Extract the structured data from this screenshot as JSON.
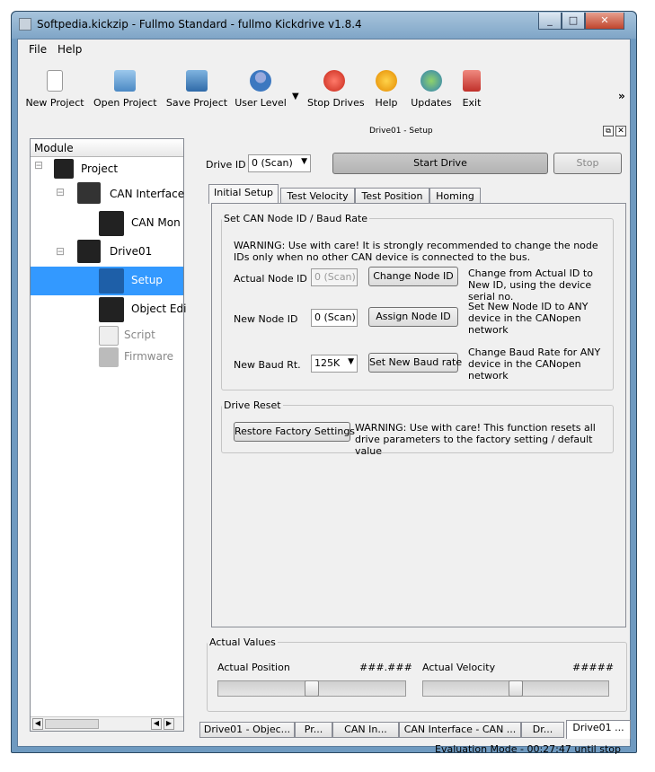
{
  "window": {
    "title": "Softpedia.kickzip - Fullmo Standard - fullmo Kickdrive v1.8.4",
    "min_icon": "minimize-icon",
    "max_icon": "maximize-icon",
    "close_icon": "close-icon"
  },
  "menu": {
    "file": "File",
    "help": "Help"
  },
  "toolbar": {
    "new_project": "New Project",
    "open_project": "Open Project",
    "save_project": "Save Project",
    "user_level": "User Level",
    "stop_drives": "Stop Drives",
    "help": "Help",
    "updates": "Updates",
    "exit": "Exit",
    "overflow": "»"
  },
  "module_panel": {
    "header": "Module",
    "items": [
      {
        "label": "Project",
        "icon": "home-icon"
      },
      {
        "label": "CAN Interface",
        "icon": "can-interface-icon"
      },
      {
        "label": "CAN Mon",
        "icon": "stethoscope-icon"
      },
      {
        "label": "Drive01",
        "icon": "drive-icon"
      },
      {
        "label": "Setup",
        "icon": "wrench-icon"
      },
      {
        "label": "Object Edi",
        "icon": "list-icon"
      },
      {
        "label": "Script",
        "icon": "script-icon"
      },
      {
        "label": "Firmware",
        "icon": "download-icon"
      }
    ]
  },
  "panel": {
    "title": "Drive01 - Setup"
  },
  "drive": {
    "label": "Drive ID",
    "value": "0 (Scan)",
    "start": "Start Drive",
    "stop": "Stop"
  },
  "tabs": [
    "Initial Setup",
    "Test Velocity",
    "Test Position",
    "Homing"
  ],
  "node_group": {
    "legend": "Set CAN Node ID / Baud Rate",
    "warning": "WARNING: Use with care! It is strongly recommended to change the node IDs only when no other CAN device is connected to the bus.",
    "actual_label": "Actual Node ID",
    "actual_value": "0 (Scan)",
    "change_button": "Change Node ID",
    "change_note": "Change from Actual ID to New ID, using the device serial no.",
    "new_label": "New Node ID",
    "new_value": "0 (Scan)",
    "assign_button": "Assign Node ID",
    "assign_note": "Set New Node ID to ANY device in the CANopen network",
    "baud_label": "New Baud Rt.",
    "baud_value": "125K",
    "baud_button": "Set New Baud rate",
    "baud_note": "Change Baud Rate for ANY device in the CANopen network"
  },
  "reset_group": {
    "legend": "Drive Reset",
    "button": "Restore Factory Settings",
    "warning": "WARNING: Use with care! This function resets all drive parameters to the factory setting / default value"
  },
  "actual_values": {
    "legend": "Actual Values",
    "position_label": "Actual Position",
    "position_value": "###.###",
    "velocity_label": "Actual Velocity",
    "velocity_value": "#####",
    "position_slider": 0.5,
    "velocity_slider": 0.5
  },
  "bottom_tabs": [
    "Drive01 - Objec...",
    "Pr...",
    "CAN In...",
    "CAN Interface - CAN ...",
    "Dr...",
    "Drive01 ..."
  ],
  "status": "Evaluation Mode - 00:27:47 until stop",
  "colors": {
    "selection": "#3399ff",
    "frame": "#6f9ac0"
  }
}
